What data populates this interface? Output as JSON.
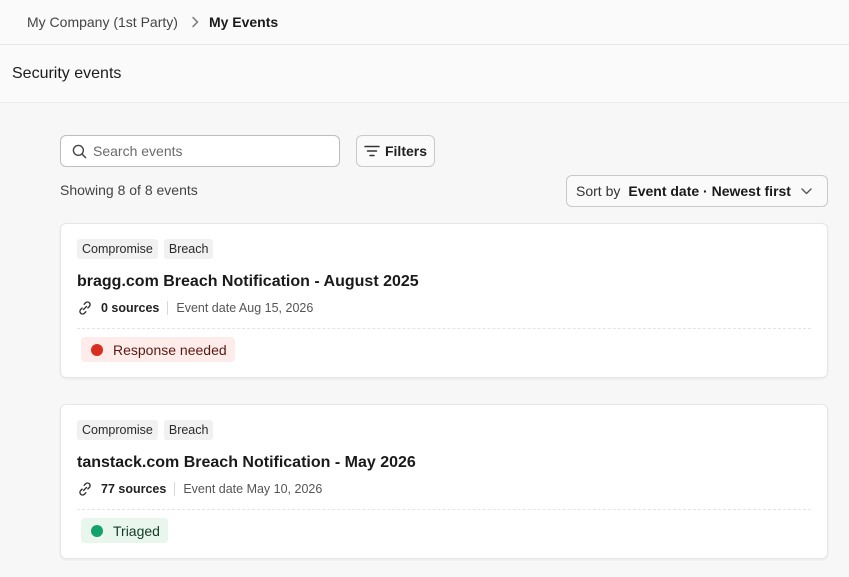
{
  "breadcrumb": {
    "parent": "My Company (1st Party)",
    "separator_icon": "chevron-right-icon",
    "current": "My Events"
  },
  "page": {
    "title": "Security events"
  },
  "search": {
    "placeholder": "Search events",
    "value": "",
    "icon": "search-icon"
  },
  "filters": {
    "label": "Filters",
    "icon": "filter-icon"
  },
  "results": {
    "showing_text": "Showing 8 of 8 events"
  },
  "sort": {
    "label": "Sort by",
    "value": "Event date · Newest first",
    "icon": "chevron-down-icon"
  },
  "events": [
    {
      "tags": [
        "Compromise",
        "Breach"
      ],
      "title": "bragg.com Breach Notification - August 2025",
      "sources": "0 sources",
      "event_date": "Event date Aug 15, 2026",
      "status": {
        "label": "Response needed",
        "dot_color": "#d92d20",
        "bg": "#fdecea",
        "text_color": "#5a1a14"
      }
    },
    {
      "tags": [
        "Compromise",
        "Breach"
      ],
      "title": "tanstack.com Breach Notification - May 2026",
      "sources": "77 sources",
      "event_date": "Event date May 10, 2026",
      "status": {
        "label": "Triaged",
        "dot_color": "#12a26b",
        "bg": "#e8f6ee",
        "text_color": "#123b26"
      }
    }
  ]
}
